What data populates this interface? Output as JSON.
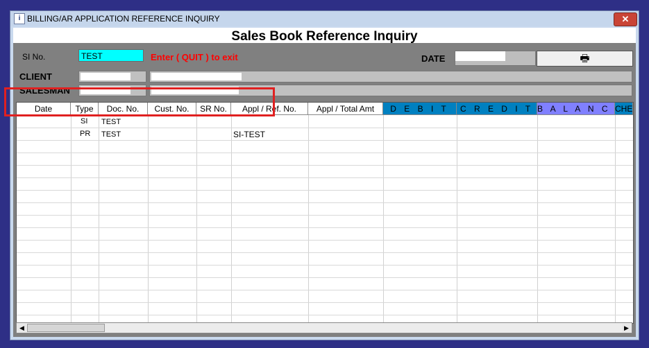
{
  "window": {
    "title": "BILLING/AR APPLICATION REFERENCE INQUIRY",
    "icon": "app-icon",
    "close_glyph": "✕"
  },
  "form": {
    "title": "Sales Book Reference Inquiry",
    "si_no_label": "SI No.",
    "si_no_value": "TEST",
    "quit_message": "Enter ( QUIT ) to exit",
    "date_label": "DATE",
    "print_glyph": "🖶",
    "client_label": "CLIENT",
    "salesman_label": "SALESMAN"
  },
  "grid": {
    "columns": [
      "Date",
      "Type",
      "Doc. No.",
      "Cust. No.",
      "SR No.",
      "Appl / Ref. No.",
      "Appl / Total Amt",
      "D E B I T",
      "C R E D I T",
      "B A L A N C E",
      "CHE"
    ],
    "rows": [
      {
        "date": "",
        "type": "SI",
        "doc_no": "TEST",
        "cust_no": "",
        "sr_no": "",
        "ref_no": ""
      },
      {
        "date": "",
        "type": "PR",
        "doc_no": "TEST",
        "cust_no": "",
        "sr_no": "",
        "ref_no": "SI-TEST"
      }
    ]
  },
  "scrollbar": {
    "left_arrow": "◀",
    "right_arrow": "▶"
  },
  "colors": {
    "si_input_bg": "#00ffff",
    "quit_text": "#ff0000",
    "debit_header": "#0080c0",
    "credit_header": "#0080c0",
    "balance_header": "#8080ff",
    "highlight": "#e02020"
  }
}
